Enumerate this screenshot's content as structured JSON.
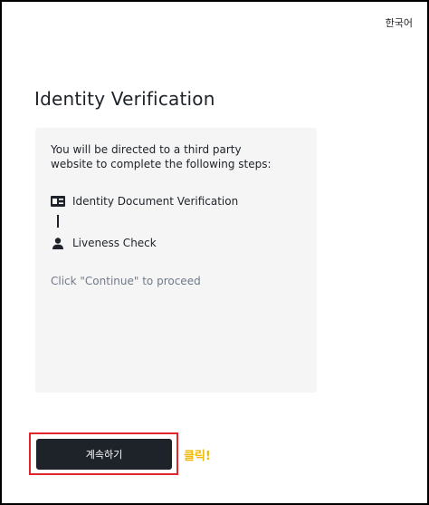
{
  "header": {
    "language_label": "한국어"
  },
  "main": {
    "title": "Identity Verification",
    "panel": {
      "intro": "You will be directed to a third party website to complete the following steps:",
      "steps": [
        {
          "label": "Identity Document Verification",
          "icon": "id-card-icon"
        },
        {
          "label": "Liveness Check",
          "icon": "person-icon"
        }
      ],
      "proceed_hint": "Click \"Continue\" to proceed"
    },
    "continue_button": "계속하기"
  },
  "annotation": {
    "click_label": "클릭!",
    "highlight_color": "#e0262a",
    "label_color": "#f0b90b"
  },
  "colors": {
    "button_bg": "#1e2329",
    "panel_bg": "#f5f5f5",
    "hint_text": "#707a8a"
  }
}
